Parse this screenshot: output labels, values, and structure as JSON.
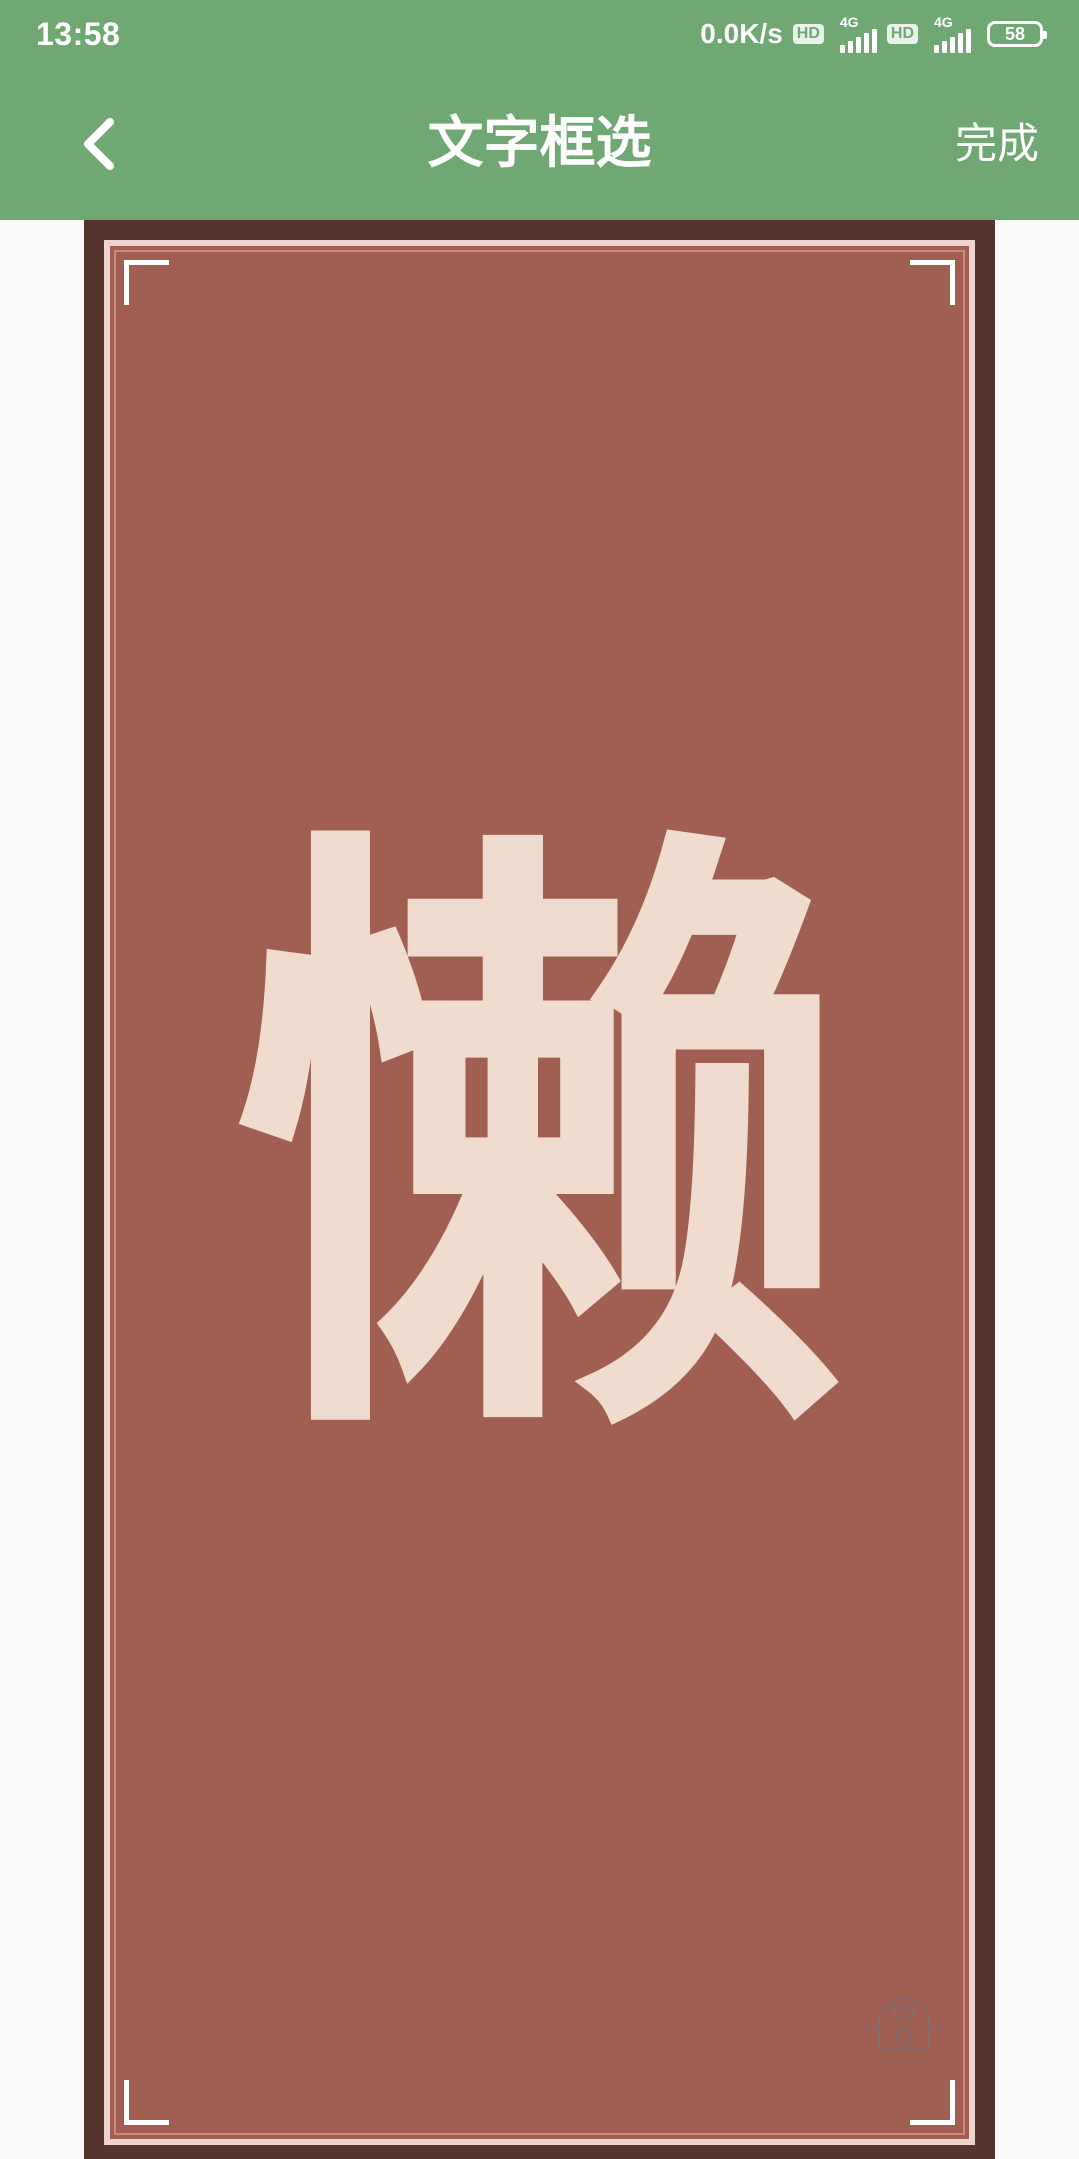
{
  "status_bar": {
    "time": "13:58",
    "speed": "0.0K/s",
    "hd_badge": "HD",
    "network_1": "4G",
    "network_2": "4G",
    "battery": "58"
  },
  "app_bar": {
    "title": "文字框选",
    "done_label": "完成",
    "back_icon": "chevron-left-icon"
  },
  "image": {
    "character": "懒",
    "background_color": "#a05f51",
    "text_color": "#f0dbcf",
    "frame_color": "#56332b"
  },
  "colors": {
    "accent": "#6fa873"
  }
}
